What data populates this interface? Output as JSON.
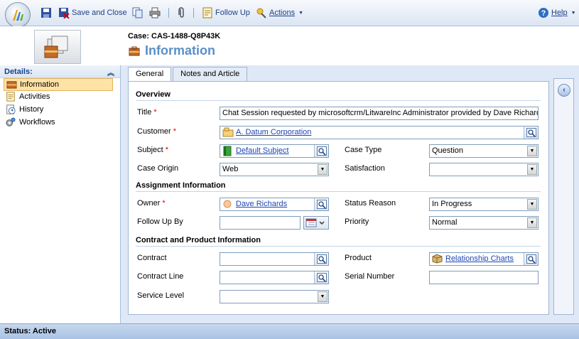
{
  "toolbar": {
    "save_close": "Save and Close",
    "follow_up": "Follow Up",
    "actions": "Actions",
    "help": "Help"
  },
  "header": {
    "case_number": "Case: CAS-1488-Q8P43K",
    "title": "Information"
  },
  "nav": {
    "header": "Details:",
    "items": [
      {
        "label": "Information",
        "icon": "information-icon"
      },
      {
        "label": "Activities",
        "icon": "activities-icon"
      },
      {
        "label": "History",
        "icon": "history-icon"
      },
      {
        "label": "Workflows",
        "icon": "workflows-icon"
      }
    ]
  },
  "tabs": [
    "General",
    "Notes and Article"
  ],
  "form": {
    "overview": "Overview",
    "title_label": "Title",
    "title_value": "Chat Session requested by microsoftcrm/LitwareInc Administrator provided by Dave Richards",
    "customer_label": "Customer",
    "customer_value": "A. Datum Corporation",
    "subject_label": "Subject",
    "subject_value": "Default Subject",
    "case_type_label": "Case Type",
    "case_type_value": "Question",
    "case_origin_label": "Case Origin",
    "case_origin_value": "Web",
    "satisfaction_label": "Satisfaction",
    "satisfaction_value": "",
    "assignment": "Assignment Information",
    "owner_label": "Owner",
    "owner_value": "Dave Richards",
    "status_reason_label": "Status Reason",
    "status_reason_value": "In Progress",
    "follow_up_label": "Follow Up By",
    "priority_label": "Priority",
    "priority_value": "Normal",
    "contract_section": "Contract and Product Information",
    "contract_label": "Contract",
    "product_label": "Product",
    "product_value": "Relationship Charts",
    "contract_line_label": "Contract Line",
    "serial_label": "Serial Number",
    "service_level_label": "Service Level",
    "required_mark": "*"
  },
  "status": "Status: Active"
}
